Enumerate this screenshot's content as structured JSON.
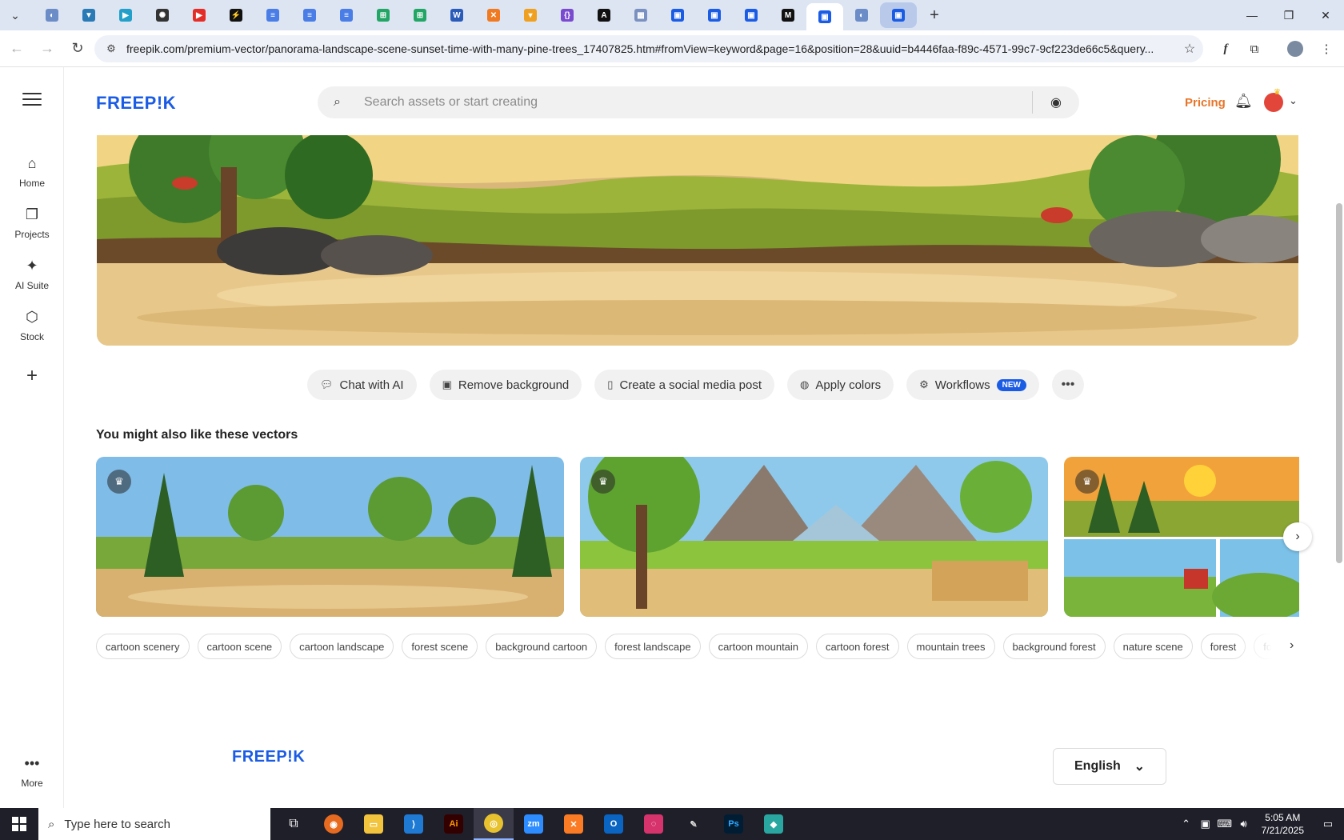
{
  "browser": {
    "tabs_icons": [
      "globe-icon",
      "shield-icon",
      "play-icon",
      "openai-icon",
      "youtube-icon",
      "bolt-icon",
      "docs-icon",
      "docs-icon",
      "docs-icon",
      "sheets-icon",
      "sheets-icon",
      "word-icon",
      "xampp-icon",
      "fox-icon",
      "code-icon",
      "notion-icon",
      "photo-icon",
      "freepik-icon",
      "freepik-icon",
      "freepik-icon",
      "medium-icon",
      "freepik-icon",
      "globe-icon",
      "freepik-icon"
    ],
    "url": "freepik.com/premium-vector/panorama-landscape-scene-sunset-time-with-many-pine-trees_17407825.htm#fromView=keyword&page=16&position=28&uuid=b4446faa-f89c-4571-99c7-9cf223de66c5&query..."
  },
  "sidebar": {
    "items": [
      {
        "label": "Home",
        "icon": "home-icon"
      },
      {
        "label": "Projects",
        "icon": "folder-icon"
      },
      {
        "label": "AI Suite",
        "icon": "sparkle-icon"
      },
      {
        "label": "Stock",
        "icon": "stock-icon"
      }
    ],
    "more_label": "More"
  },
  "header": {
    "logo": "FREEP!K",
    "search_placeholder": "Search assets or start creating",
    "pricing_label": "Pricing"
  },
  "actions": [
    {
      "label": "Chat with AI",
      "icon": "chat-icon"
    },
    {
      "label": "Remove background",
      "icon": "remove-bg-icon"
    },
    {
      "label": "Create a social media post",
      "icon": "phone-icon"
    },
    {
      "label": "Apply colors",
      "icon": "palette-icon"
    },
    {
      "label": "Workflows",
      "icon": "workflow-icon",
      "badge": "NEW"
    }
  ],
  "related": {
    "title": "You might also like these vectors"
  },
  "tags": [
    "cartoon scenery",
    "cartoon scene",
    "cartoon landscape",
    "forest scene",
    "background cartoon",
    "forest landscape",
    "cartoon mountain",
    "cartoon forest",
    "mountain trees",
    "background forest",
    "nature scene",
    "forest",
    "forest tre"
  ],
  "footer": {
    "logo": "FREEP!K",
    "language": "English"
  },
  "taskbar": {
    "search_placeholder": "Type here to search",
    "time": "5:05 AM",
    "date": "7/21/2025"
  },
  "colors": {
    "brand_blue": "#1b5ce5",
    "pricing_orange": "#e8752a"
  }
}
